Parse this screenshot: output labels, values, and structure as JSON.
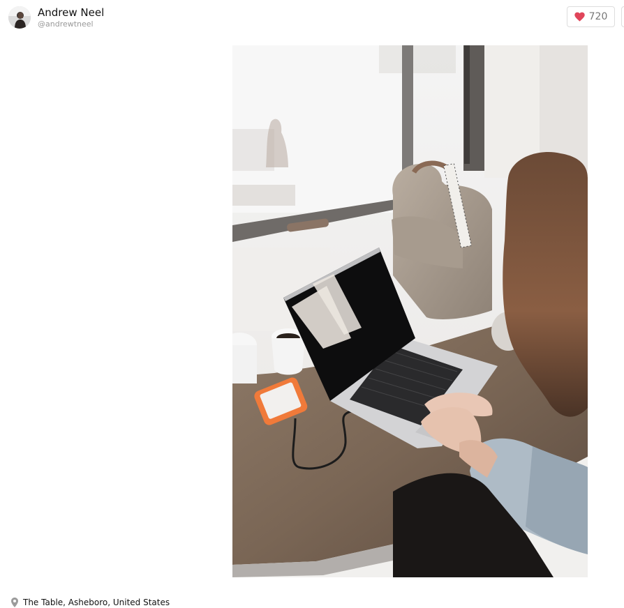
{
  "author": {
    "name": "Andrew Neel",
    "handle": "@andrewtneel",
    "avatar_icon": "user-avatar"
  },
  "actions": {
    "like_icon": "heart-icon",
    "like_count": "720",
    "like_color": "#e0455a"
  },
  "photo": {
    "description_icon": "photo-woman-laptop-cafe"
  },
  "location": {
    "icon": "map-pin-icon",
    "text": "The Table, Asheboro, United States"
  }
}
